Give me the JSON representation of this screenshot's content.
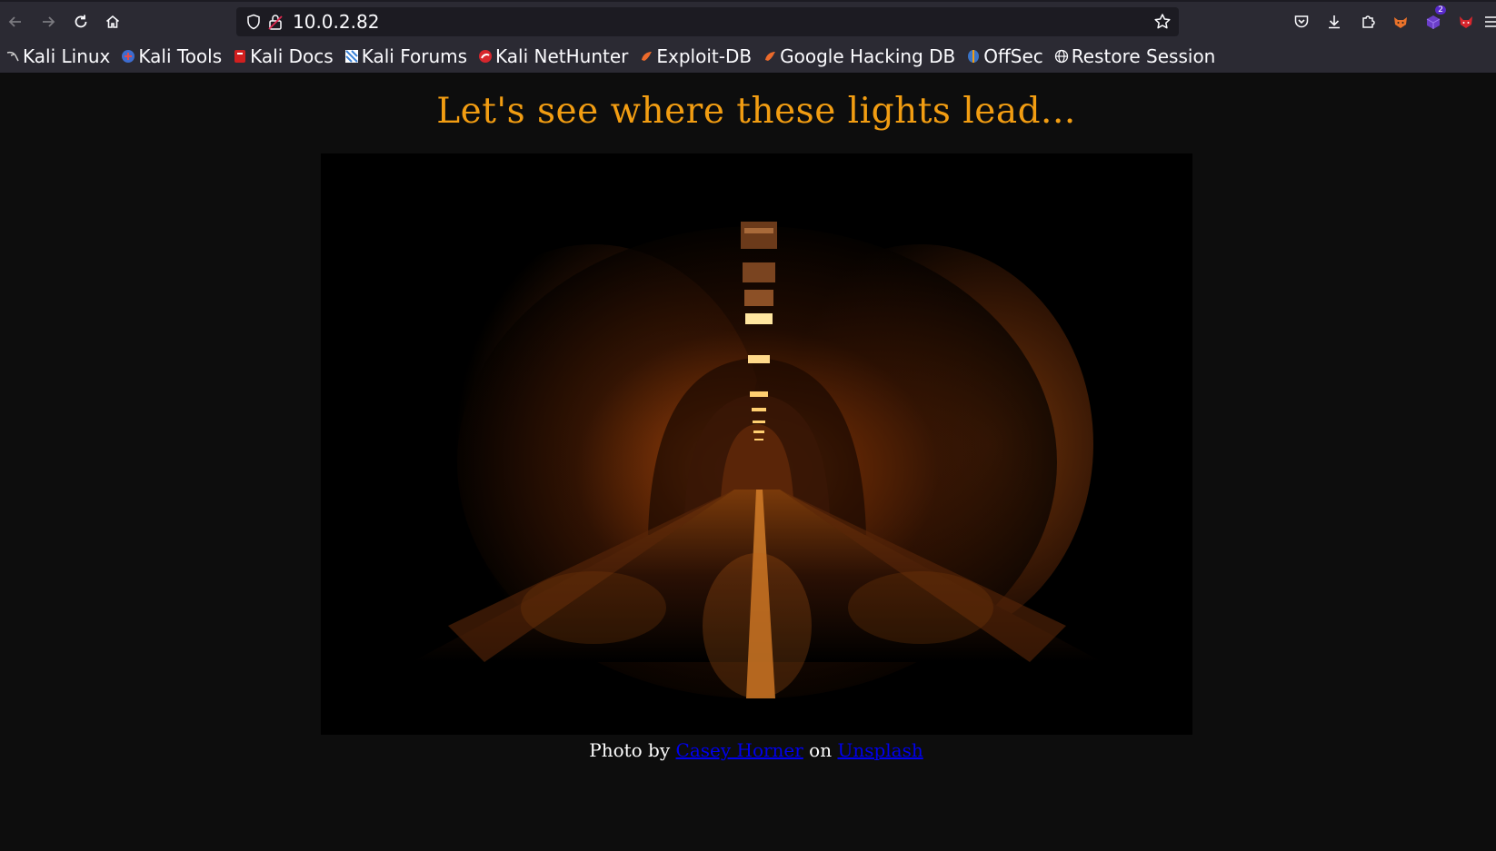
{
  "browser": {
    "url": "10.0.2.82",
    "bookmarks": [
      {
        "label": "Kali Linux",
        "icon": "kali-linux-icon",
        "color": "#1a1a1a"
      },
      {
        "label": "Kali Tools",
        "icon": "kali-tools-icon",
        "color": "#3d6ccf"
      },
      {
        "label": "Kali Docs",
        "icon": "kali-docs-icon",
        "color": "#d11f1f"
      },
      {
        "label": "Kali Forums",
        "icon": "kali-forums-icon",
        "color": "#3b82d6"
      },
      {
        "label": "Kali NetHunter",
        "icon": "kali-nethunter-icon",
        "color": "#d8262d"
      },
      {
        "label": "Exploit-DB",
        "icon": "exploit-db-icon",
        "color": "#ec6a2b"
      },
      {
        "label": "Google Hacking DB",
        "icon": "google-hacking-db-icon",
        "color": "#ec6a2b"
      },
      {
        "label": "OffSec",
        "icon": "offsec-icon",
        "color": "#3a73c6"
      },
      {
        "label": "Restore Session",
        "icon": "globe-icon",
        "color": "#fbfbfe"
      }
    ],
    "extension_badge": "2"
  },
  "page": {
    "headline": "Let's see where these lights lead...",
    "caption": {
      "prefix": "Photo by ",
      "author": "Casey Horner",
      "middle": " on ",
      "site": "Unsplash"
    },
    "colors": {
      "background": "#0d0d0d",
      "headline": "#f29d12",
      "link": "#0000ee"
    }
  }
}
